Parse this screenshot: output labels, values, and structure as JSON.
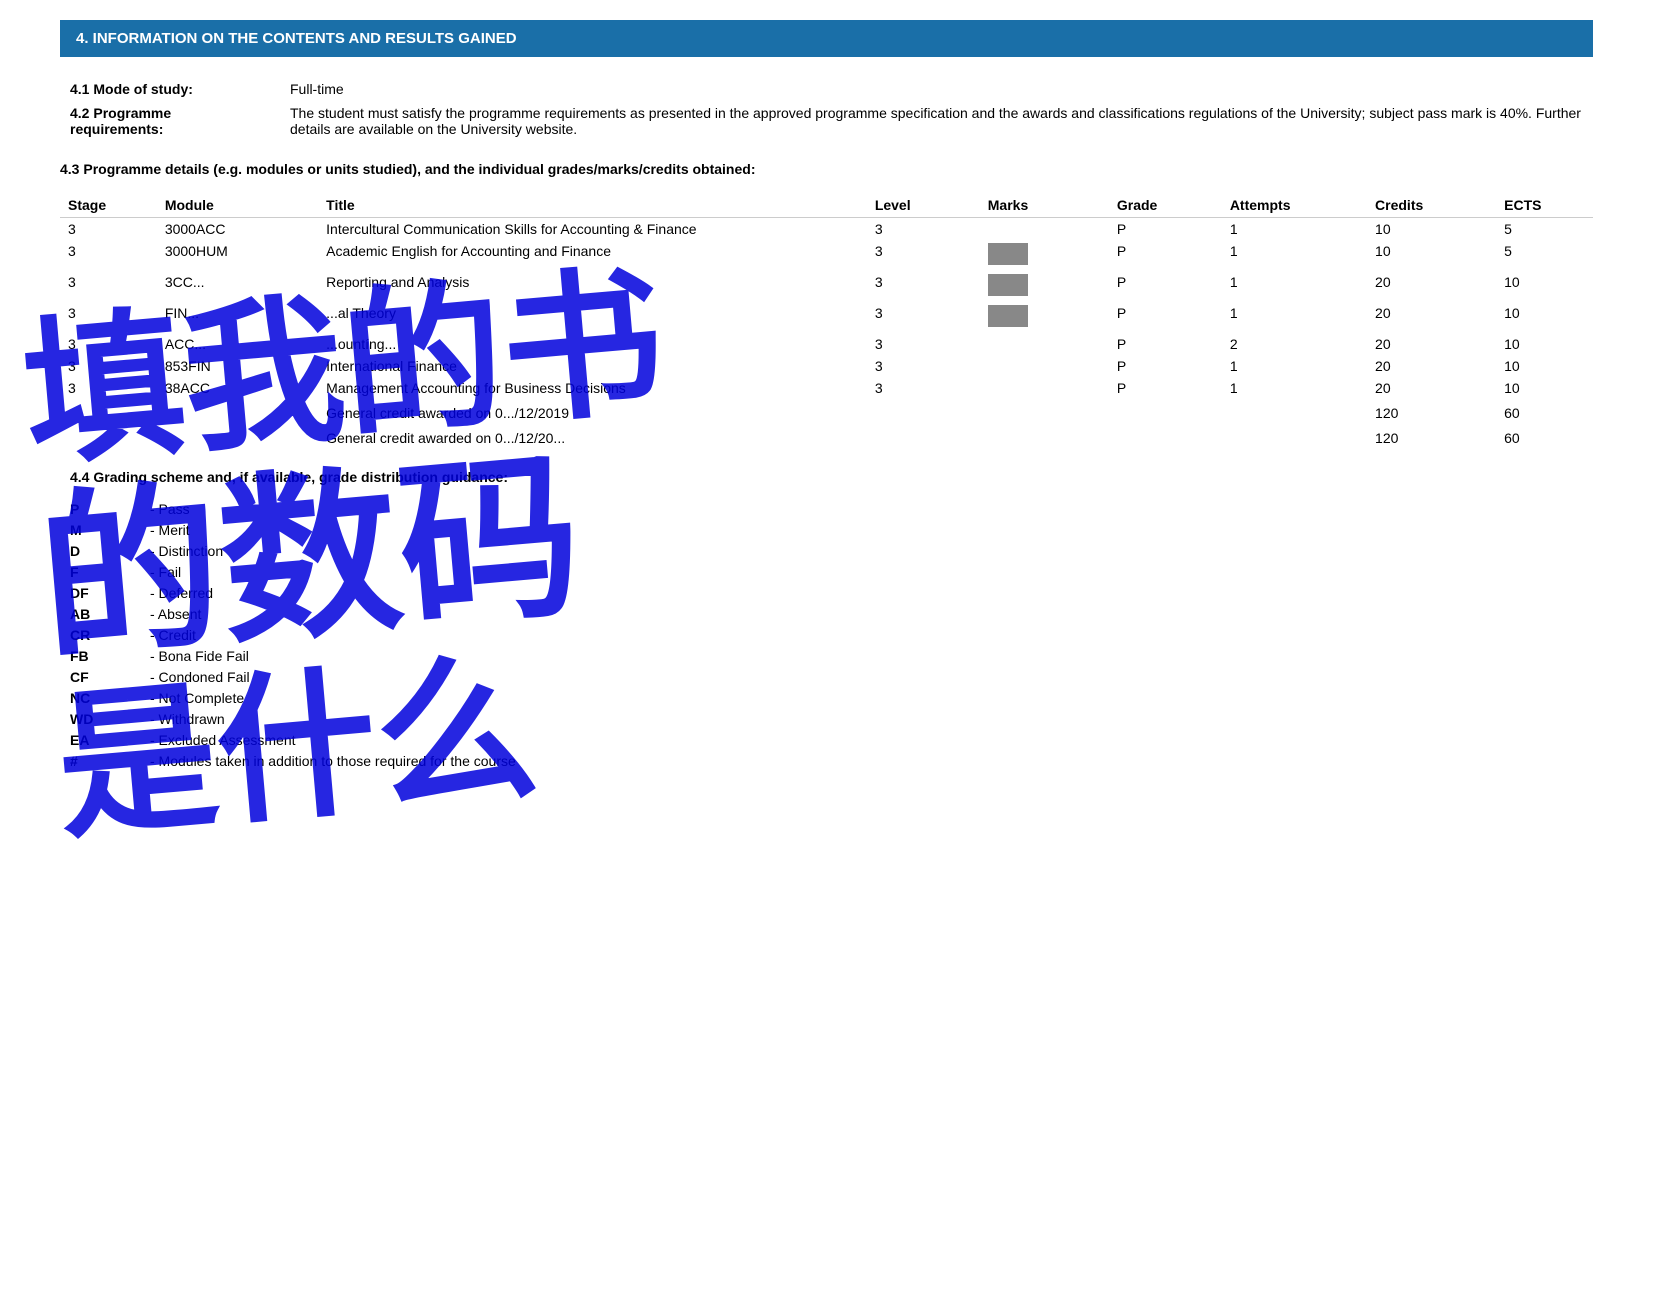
{
  "section": {
    "header": "4. INFORMATION ON THE CONTENTS AND RESULTS GAINED"
  },
  "mode_of_study": {
    "label": "4.1 Mode of study:",
    "value": "Full-time"
  },
  "programme_requirements": {
    "label1": "4.2 Programme",
    "label2": "requirements:",
    "value": "The student must satisfy the programme requirements as presented in the approved programme specification and the awards and classifications regulations of the University; subject pass mark is 40%. Further details are available on the University website."
  },
  "programme_details_title": "4.3 Programme details (e.g. modules or units studied), and the individual grades/marks/credits obtained:",
  "table": {
    "headers": {
      "stage": "Stage",
      "module": "Module",
      "title": "Title",
      "level": "Level",
      "marks": "Marks",
      "grade": "Grade",
      "attempts": "Attempts",
      "credits": "Credits",
      "ects": "ECTS"
    },
    "rows": [
      {
        "stage": "3",
        "module": "3000ACC",
        "title": "Intercultural Communication Skills for Accounting & Finance",
        "level": "3",
        "marks": "",
        "grade": "P",
        "attempts": "1",
        "credits": "10",
        "ects": "5",
        "marks_redacted": false
      },
      {
        "stage": "3",
        "module": "3000HUM",
        "title": "Academic English for Accounting and Finance",
        "level": "3",
        "marks": "",
        "grade": "P",
        "attempts": "1",
        "credits": "10",
        "ects": "5",
        "marks_redacted": true
      },
      {
        "stage": "3",
        "module": "3CC...",
        "title": "Reporting and Analysis",
        "level": "3",
        "marks": "",
        "grade": "P",
        "attempts": "1",
        "credits": "20",
        "ects": "10",
        "marks_redacted": true,
        "obscured": true
      },
      {
        "stage": "3",
        "module": "FIN...",
        "title": "...al Theory",
        "level": "3",
        "marks": "",
        "grade": "P",
        "attempts": "1",
        "credits": "20",
        "ects": "10",
        "marks_redacted": true,
        "obscured": true
      },
      {
        "stage": "3",
        "module": "ACC...",
        "title": "...ountíng...",
        "level": "3",
        "marks": "",
        "grade": "P",
        "attempts": "2",
        "credits": "20",
        "ects": "10",
        "obscured": true
      },
      {
        "stage": "3",
        "module": "853FIN",
        "title": "International Finance",
        "level": "3",
        "marks": "",
        "grade": "P",
        "attempts": "1",
        "credits": "20",
        "ects": "10",
        "obscured": true
      },
      {
        "stage": "3",
        "module": "38ACC",
        "title": "Management Accounting for Business Decisions",
        "level": "3",
        "marks": "",
        "grade": "P",
        "attempts": "1",
        "credits": "20",
        "ects": "10",
        "obscured": true
      }
    ],
    "general_credit_rows": [
      {
        "label": "General credit awarded on 0.../12/2019",
        "credits": "120",
        "ects": "60"
      },
      {
        "label": "General credit awarded on 0.../12/20...",
        "credits": "120",
        "ects": "60"
      }
    ]
  },
  "grading_scheme": {
    "title": "4.4 Grading scheme and, if available, grade distribution guidance:",
    "items": [
      {
        "code": "P",
        "desc": "- Pass"
      },
      {
        "code": "M",
        "desc": "- Merit"
      },
      {
        "code": "D",
        "desc": "- Distinction"
      },
      {
        "code": "F",
        "desc": "- Fail"
      },
      {
        "code": "DF",
        "desc": "- Deferred"
      },
      {
        "code": "AB",
        "desc": "- Absent"
      },
      {
        "code": "CR",
        "desc": "- Credit"
      },
      {
        "code": "FB",
        "desc": "- Bona Fide Fail"
      },
      {
        "code": "CF",
        "desc": "- Condoned Fail"
      },
      {
        "code": "NC",
        "desc": "- Not Complete"
      },
      {
        "code": "WD",
        "desc": "- Withdrawn"
      },
      {
        "code": "EA",
        "desc": "- Excluded Assessment"
      },
      {
        "code": "#",
        "desc": "- Modules taken in addition to those required for the course"
      }
    ]
  },
  "watermark": {
    "lines": [
      "填我的书",
      "的数码",
      "是什么"
    ]
  }
}
